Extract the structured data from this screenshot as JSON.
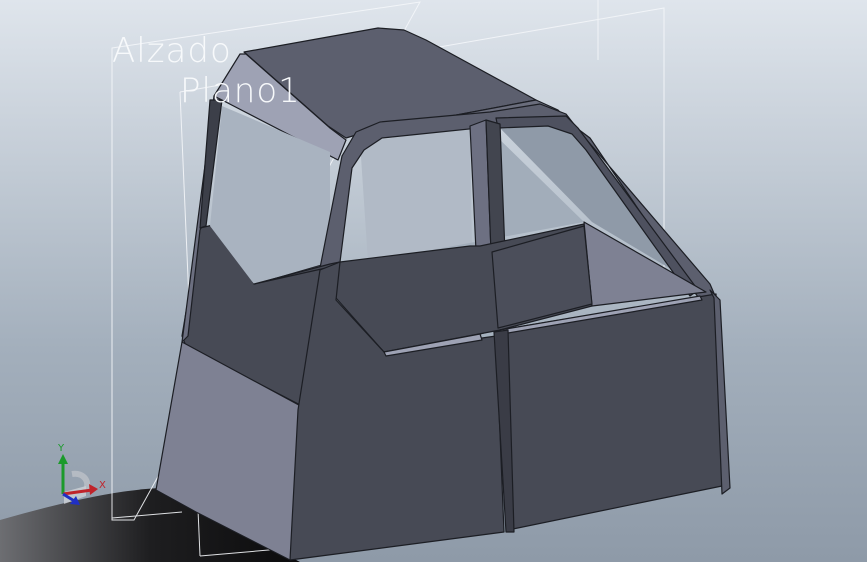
{
  "viewport": {
    "planes": [
      {
        "label": "Alzado"
      },
      {
        "label": "Plano1"
      }
    ],
    "triad": {
      "x_label": "X",
      "y_label": "Y",
      "x_color": "#c0242b",
      "y_color": "#1b9a2b",
      "z_color": "#1f2fc4"
    },
    "model": {
      "description_icon": "cab-body-3d-model",
      "face_colors": {
        "dark": "#474a55",
        "medium": "#5c5f6e",
        "light": "#7e8193",
        "highlight": "#9ea2b4",
        "edge": "#1c1e24"
      }
    }
  }
}
